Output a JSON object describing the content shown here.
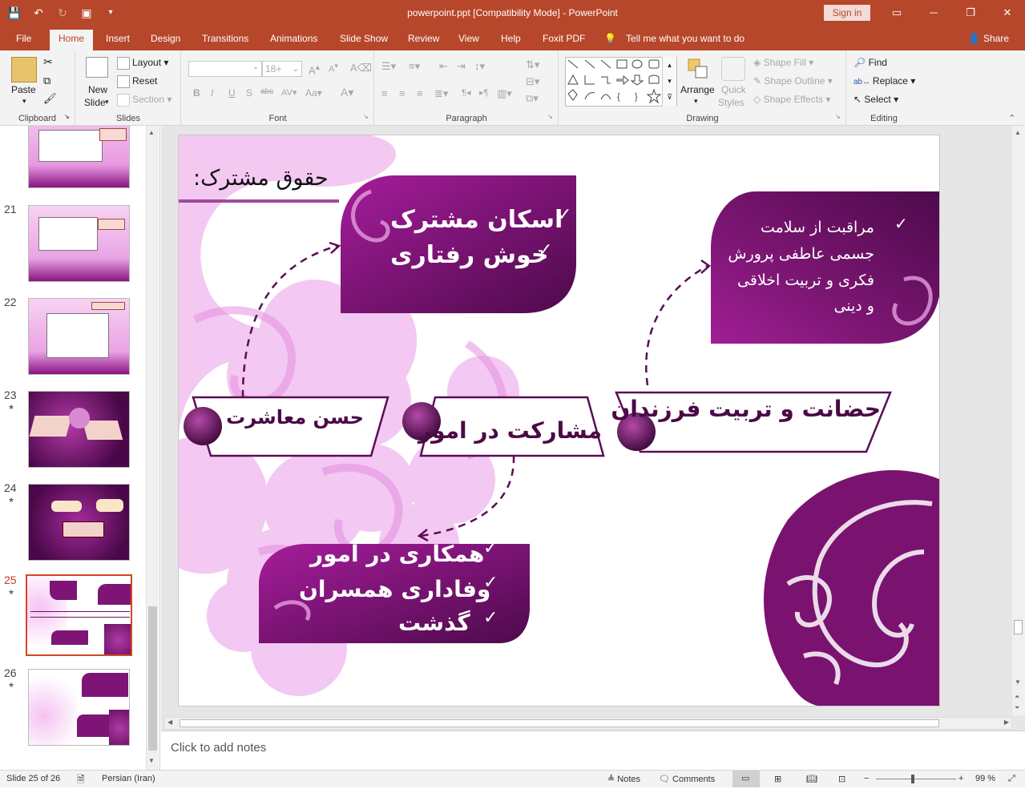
{
  "title_bar": {
    "document_title": "powerpoint.ppt [Compatibility Mode]  -  PowerPoint",
    "sign_in": "Sign in"
  },
  "tabs": [
    {
      "label": "File"
    },
    {
      "label": "Home"
    },
    {
      "label": "Insert"
    },
    {
      "label": "Design"
    },
    {
      "label": "Transitions"
    },
    {
      "label": "Animations"
    },
    {
      "label": "Slide Show"
    },
    {
      "label": "Review"
    },
    {
      "label": "View"
    },
    {
      "label": "Help"
    },
    {
      "label": "Foxit PDF"
    }
  ],
  "tell_me": "Tell me what you want to do",
  "share": "Share",
  "ribbon": {
    "clipboard": {
      "label": "Clipboard",
      "paste": "Paste"
    },
    "slides": {
      "label": "Slides",
      "new_slide_line1": "New",
      "new_slide_line2": "Slide",
      "layout": "Layout",
      "reset": "Reset",
      "section": "Section"
    },
    "font": {
      "label": "Font",
      "font_name": "",
      "font_size": "18+"
    },
    "paragraph": {
      "label": "Paragraph"
    },
    "drawing": {
      "label": "Drawing",
      "arrange": "Arrange",
      "quick_styles_line1": "Quick",
      "quick_styles_line2": "Styles",
      "shape_fill": "Shape Fill",
      "shape_outline": "Shape Outline",
      "shape_effects": "Shape Effects"
    },
    "editing": {
      "label": "Editing",
      "find": "Find",
      "replace": "Replace",
      "select": "Select"
    }
  },
  "thumbnails": [
    {
      "number": "",
      "star": false
    },
    {
      "number": "21",
      "star": false
    },
    {
      "number": "22",
      "star": false
    },
    {
      "number": "23",
      "star": true
    },
    {
      "number": "24",
      "star": true
    },
    {
      "number": "25",
      "star": true
    },
    {
      "number": "26",
      "star": true
    }
  ],
  "slide": {
    "heading": "حقوق مشترک:",
    "box_top_left": {
      "line1": "اسکان مشترک",
      "line2": "خوش رفتاری"
    },
    "box_top_right": {
      "line1": "مراقبت از سلامت",
      "line2": "جسمی عاطفی پرورش",
      "line3": "فکری و تربیت اخلاقی",
      "line4": "و دینی"
    },
    "label_right": "حضانت و تربیت فرزندان",
    "label_middle": "مشارکت در امور",
    "label_left": "حسن معاشرت",
    "box_bottom": {
      "line1": "همکاری در امور",
      "line2": "وفاداری همسران",
      "line3": "گذشت"
    },
    "check_mark": "✓"
  },
  "notes_placeholder": "Click to add notes",
  "status": {
    "slide_counter": "Slide 25 of 26",
    "language": "Persian (Iran)",
    "notes": "Notes",
    "comments": "Comments",
    "zoom": "99 %"
  },
  "colors": {
    "brand": "#b7472a",
    "purple_dark": "#5e0f5a",
    "purple_mid": "#8b1a7d",
    "pink_light": "#efb6ec"
  }
}
